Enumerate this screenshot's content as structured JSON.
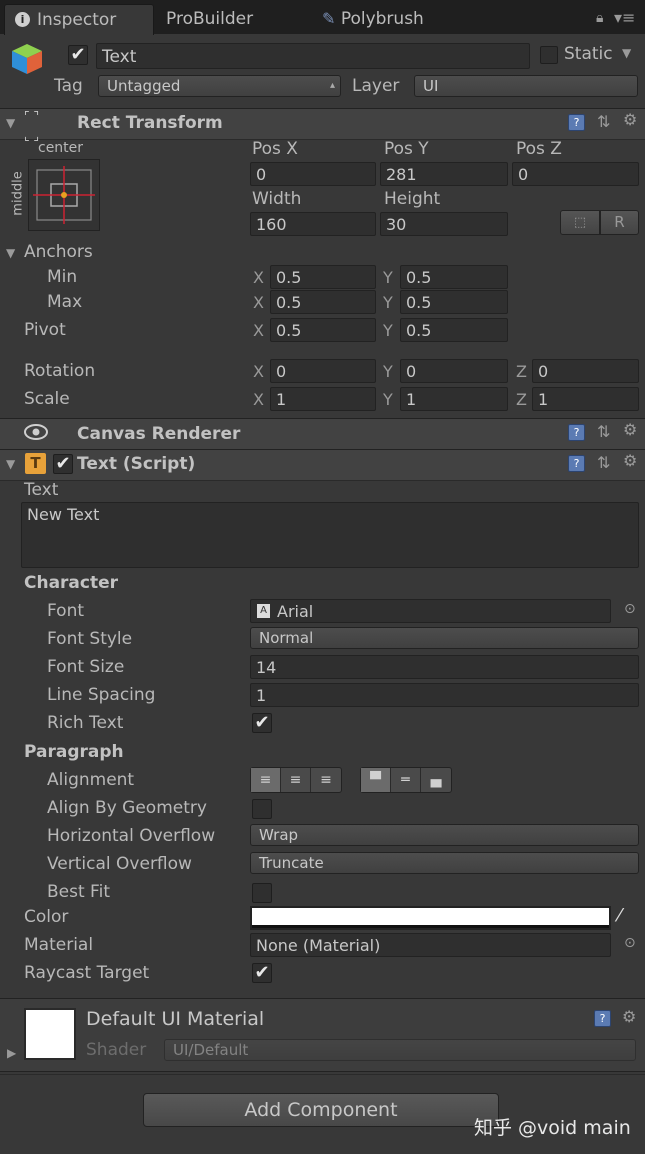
{
  "tabs": [
    {
      "label": "Inspector"
    },
    {
      "label": "ProBuilder"
    },
    {
      "label": "Polybrush"
    }
  ],
  "object": {
    "name": "Text",
    "static_label": "Static",
    "tag_label": "Tag",
    "tag_value": "Untagged",
    "layer_label": "Layer",
    "layer_value": "UI"
  },
  "rect_transform": {
    "title": "Rect Transform",
    "anchor_h": "center",
    "anchor_v": "middle",
    "pos_x_label": "Pos X",
    "pos_y_label": "Pos Y",
    "pos_z_label": "Pos Z",
    "pos_x": "0",
    "pos_y": "281",
    "pos_z": "0",
    "width_label": "Width",
    "height_label": "Height",
    "width": "160",
    "height": "30",
    "r_button": "R",
    "anchors_label": "Anchors",
    "min_label": "Min",
    "max_label": "Max",
    "min_x": "0.5",
    "min_y": "0.5",
    "max_x": "0.5",
    "max_y": "0.5",
    "pivot_label": "Pivot",
    "pivot_x": "0.5",
    "pivot_y": "0.5",
    "rotation_label": "Rotation",
    "rot_x": "0",
    "rot_y": "0",
    "rot_z": "0",
    "scale_label": "Scale",
    "scale_x": "1",
    "scale_y": "1",
    "scale_z": "1",
    "axis_x": "X",
    "axis_y": "Y",
    "axis_z": "Z"
  },
  "canvas_renderer": {
    "title": "Canvas Renderer"
  },
  "text_script": {
    "title": "Text (Script)",
    "text_label": "Text",
    "text_value": "New Text",
    "character_label": "Character",
    "font_label": "Font",
    "font_value": "Arial",
    "font_style_label": "Font Style",
    "font_style_value": "Normal",
    "font_size_label": "Font Size",
    "font_size_value": "14",
    "line_spacing_label": "Line Spacing",
    "line_spacing_value": "1",
    "rich_text_label": "Rich Text",
    "rich_text_checked": true,
    "paragraph_label": "Paragraph",
    "alignment_label": "Alignment",
    "align_geom_label": "Align By Geometry",
    "align_geom_checked": false,
    "h_overflow_label": "Horizontal Overflow",
    "h_overflow_value": "Wrap",
    "v_overflow_label": "Vertical Overflow",
    "v_overflow_value": "Truncate",
    "best_fit_label": "Best Fit",
    "best_fit_checked": false,
    "color_label": "Color",
    "color_value": "#ffffff",
    "material_label": "Material",
    "material_value": "None (Material)",
    "raycast_label": "Raycast Target",
    "raycast_checked": true
  },
  "material_block": {
    "title": "Default UI Material",
    "shader_label": "Shader",
    "shader_value": "UI/Default"
  },
  "add_component": "Add Component",
  "watermark": "知乎 @void main"
}
